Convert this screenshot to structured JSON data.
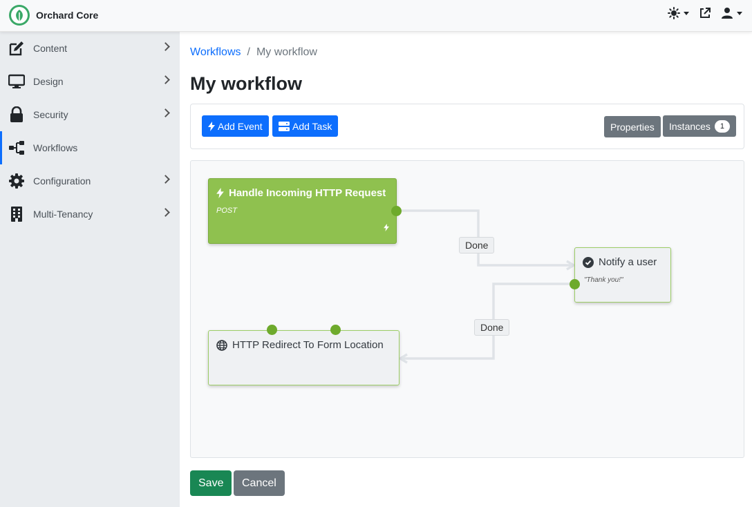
{
  "app": {
    "name": "Orchard Core"
  },
  "sidebar": {
    "items": [
      {
        "label": "Content",
        "icon": "edit-icon",
        "has_submenu": true
      },
      {
        "label": "Design",
        "icon": "monitor-icon",
        "has_submenu": true
      },
      {
        "label": "Security",
        "icon": "lock-icon",
        "has_submenu": true
      },
      {
        "label": "Workflows",
        "icon": "sitemap-icon",
        "has_submenu": false,
        "active": true
      },
      {
        "label": "Configuration",
        "icon": "gear-icon",
        "has_submenu": true
      },
      {
        "label": "Multi-Tenancy",
        "icon": "building-icon",
        "has_submenu": true
      }
    ]
  },
  "breadcrumb": {
    "parent": "Workflows",
    "separator": "/",
    "current": "My workflow"
  },
  "page": {
    "title": "My workflow"
  },
  "toolbar": {
    "add_event": "Add Event",
    "add_task": "Add Task",
    "properties": "Properties",
    "instances": "Instances",
    "instances_count": "1"
  },
  "workflow": {
    "activities": {
      "http_request": {
        "title": "Handle Incoming HTTP Request",
        "subtitle": "POST"
      },
      "notify_user": {
        "title": "Notify a user",
        "subtitle": "\"Thank you!\""
      },
      "http_redirect": {
        "title": "HTTP Redirect To Form Location"
      }
    },
    "connections": [
      {
        "label": "Done"
      },
      {
        "label": "Done"
      }
    ]
  },
  "footer": {
    "save": "Save",
    "cancel": "Cancel"
  },
  "colors": {
    "primary": "#0d6efd",
    "secondary": "#6c757d",
    "success": "#198754",
    "event_activity": "#8fc14f",
    "endpoint": "#6eaa2c"
  }
}
